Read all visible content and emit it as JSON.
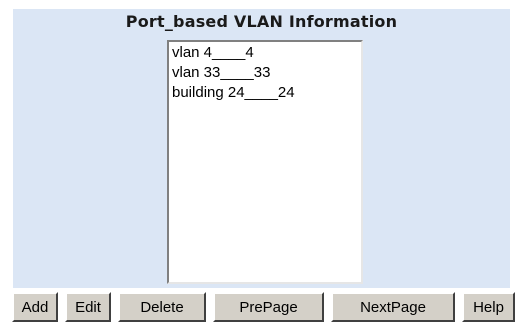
{
  "title": "Port_based VLAN Information",
  "vlan_list": [
    "vlan 4____4",
    "vlan 33____33",
    "building 24____24"
  ],
  "buttons": {
    "add": "Add",
    "edit": "Edit",
    "delete": "Delete",
    "prepage": "PrePage",
    "nextpage": "NextPage",
    "help": "Help"
  }
}
